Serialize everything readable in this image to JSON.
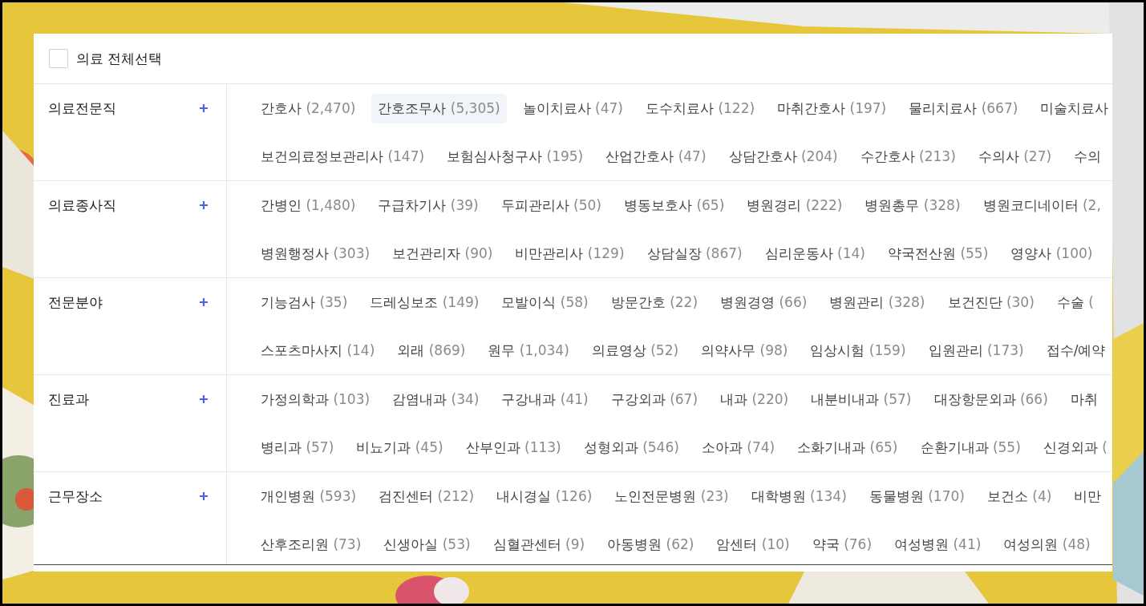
{
  "select_all": {
    "label": "의료 전체선택",
    "checked": false
  },
  "sections": [
    {
      "title": "의료전문직",
      "lines": [
        [
          {
            "label": "간호사",
            "count": "(2,470)",
            "selected": false
          },
          {
            "label": "간호조무사",
            "count": "(5,305)",
            "selected": true
          },
          {
            "label": "놀이치료사",
            "count": "(47)",
            "selected": false
          },
          {
            "label": "도수치료사",
            "count": "(122)",
            "selected": false
          },
          {
            "label": "마취간호사",
            "count": "(197)",
            "selected": false
          },
          {
            "label": "물리치료사",
            "count": "(667)",
            "selected": false
          },
          {
            "label": "미술치료사",
            "selected": false
          }
        ],
        [
          {
            "label": "보건의료정보관리사",
            "count": "(147)",
            "selected": false
          },
          {
            "label": "보험심사청구사",
            "count": "(195)",
            "selected": false
          },
          {
            "label": "산업간호사",
            "count": "(47)",
            "selected": false
          },
          {
            "label": "상담간호사",
            "count": "(204)",
            "selected": false
          },
          {
            "label": "수간호사",
            "count": "(213)",
            "selected": false
          },
          {
            "label": "수의사",
            "count": "(27)",
            "selected": false
          },
          {
            "label": "수의",
            "selected": false
          }
        ]
      ]
    },
    {
      "title": "의료종사직",
      "lines": [
        [
          {
            "label": "간병인",
            "count": "(1,480)",
            "selected": false
          },
          {
            "label": "구급차기사",
            "count": "(39)",
            "selected": false
          },
          {
            "label": "두피관리사",
            "count": "(50)",
            "selected": false
          },
          {
            "label": "병동보호사",
            "count": "(65)",
            "selected": false
          },
          {
            "label": "병원경리",
            "count": "(222)",
            "selected": false
          },
          {
            "label": "병원총무",
            "count": "(328)",
            "selected": false
          },
          {
            "label": "병원코디네이터",
            "count": "(2,",
            "selected": false
          }
        ],
        [
          {
            "label": "병원행정사",
            "count": "(303)",
            "selected": false
          },
          {
            "label": "보건관리자",
            "count": "(90)",
            "selected": false
          },
          {
            "label": "비만관리사",
            "count": "(129)",
            "selected": false
          },
          {
            "label": "상담실장",
            "count": "(867)",
            "selected": false
          },
          {
            "label": "심리운동사",
            "count": "(14)",
            "selected": false
          },
          {
            "label": "약국전산원",
            "count": "(55)",
            "selected": false
          },
          {
            "label": "영양사",
            "count": "(100)",
            "selected": false
          }
        ]
      ]
    },
    {
      "title": "전문분야",
      "lines": [
        [
          {
            "label": "기능검사",
            "count": "(35)",
            "selected": false
          },
          {
            "label": "드레싱보조",
            "count": "(149)",
            "selected": false
          },
          {
            "label": "모발이식",
            "count": "(58)",
            "selected": false
          },
          {
            "label": "방문간호",
            "count": "(22)",
            "selected": false
          },
          {
            "label": "병원경영",
            "count": "(66)",
            "selected": false
          },
          {
            "label": "병원관리",
            "count": "(328)",
            "selected": false
          },
          {
            "label": "보건진단",
            "count": "(30)",
            "selected": false
          },
          {
            "label": "수술",
            "count": "(",
            "selected": false
          }
        ],
        [
          {
            "label": "스포츠마사지",
            "count": "(14)",
            "selected": false
          },
          {
            "label": "외래",
            "count": "(869)",
            "selected": false
          },
          {
            "label": "원무",
            "count": "(1,034)",
            "selected": false
          },
          {
            "label": "의료영상",
            "count": "(52)",
            "selected": false
          },
          {
            "label": "의약사무",
            "count": "(98)",
            "selected": false
          },
          {
            "label": "임상시험",
            "count": "(159)",
            "selected": false
          },
          {
            "label": "입원관리",
            "count": "(173)",
            "selected": false
          },
          {
            "label": "접수/예약",
            "selected": false
          }
        ]
      ]
    },
    {
      "title": "진료과",
      "lines": [
        [
          {
            "label": "가정의학과",
            "count": "(103)",
            "selected": false
          },
          {
            "label": "감염내과",
            "count": "(34)",
            "selected": false
          },
          {
            "label": "구강내과",
            "count": "(41)",
            "selected": false
          },
          {
            "label": "구강외과",
            "count": "(67)",
            "selected": false
          },
          {
            "label": "내과",
            "count": "(220)",
            "selected": false
          },
          {
            "label": "내분비내과",
            "count": "(57)",
            "selected": false
          },
          {
            "label": "대장항문외과",
            "count": "(66)",
            "selected": false
          },
          {
            "label": "마취",
            "selected": false
          }
        ],
        [
          {
            "label": "병리과",
            "count": "(57)",
            "selected": false
          },
          {
            "label": "비뇨기과",
            "count": "(45)",
            "selected": false
          },
          {
            "label": "산부인과",
            "count": "(113)",
            "selected": false
          },
          {
            "label": "성형외과",
            "count": "(546)",
            "selected": false
          },
          {
            "label": "소아과",
            "count": "(74)",
            "selected": false
          },
          {
            "label": "소화기내과",
            "count": "(65)",
            "selected": false
          },
          {
            "label": "순환기내과",
            "count": "(55)",
            "selected": false
          },
          {
            "label": "신경외과",
            "count": "(",
            "selected": false
          }
        ]
      ]
    },
    {
      "title": "근무장소",
      "lines": [
        [
          {
            "label": "개인병원",
            "count": "(593)",
            "selected": false
          },
          {
            "label": "검진센터",
            "count": "(212)",
            "selected": false
          },
          {
            "label": "내시경실",
            "count": "(126)",
            "selected": false
          },
          {
            "label": "노인전문병원",
            "count": "(23)",
            "selected": false
          },
          {
            "label": "대학병원",
            "count": "(134)",
            "selected": false
          },
          {
            "label": "동물병원",
            "count": "(170)",
            "selected": false
          },
          {
            "label": "보건소",
            "count": "(4)",
            "selected": false
          },
          {
            "label": "비만",
            "selected": false
          }
        ],
        [
          {
            "label": "산후조리원",
            "count": "(73)",
            "selected": false
          },
          {
            "label": "신생아실",
            "count": "(53)",
            "selected": false
          },
          {
            "label": "심혈관센터",
            "count": "(9)",
            "selected": false
          },
          {
            "label": "아동병원",
            "count": "(62)",
            "selected": false
          },
          {
            "label": "암센터",
            "count": "(10)",
            "selected": false
          },
          {
            "label": "약국",
            "count": "(76)",
            "selected": false
          },
          {
            "label": "여성병원",
            "count": "(41)",
            "selected": false
          },
          {
            "label": "여성의원",
            "count": "(48)",
            "selected": false
          }
        ]
      ]
    }
  ]
}
